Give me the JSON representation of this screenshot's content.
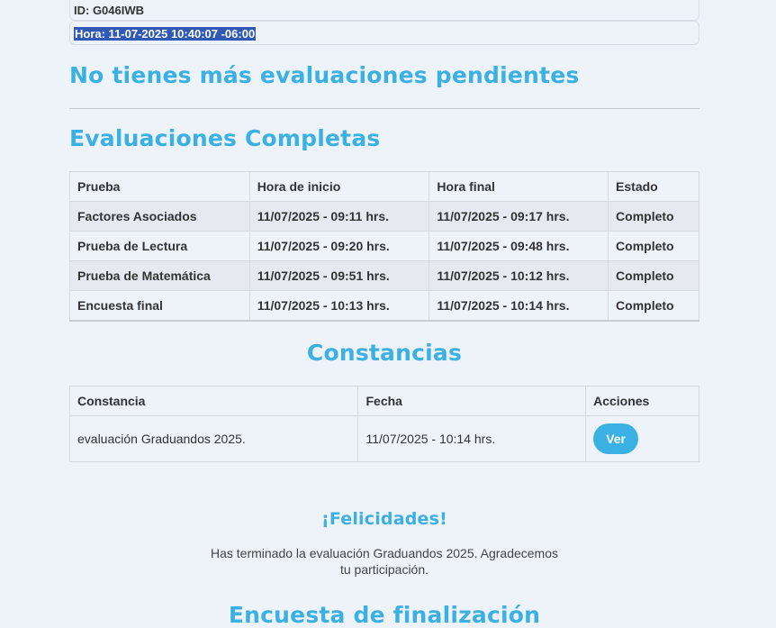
{
  "info": {
    "id_text": "ID: G046IWB",
    "hora_text": "Hora: 11-07-2025 10:40:07 -06:00"
  },
  "pending_title": "No tienes más evaluaciones pendientes",
  "completed": {
    "title": "Evaluaciones Completas",
    "headers": [
      "Prueba",
      "Hora de inicio",
      "Hora final",
      "Estado"
    ],
    "rows": [
      [
        "Factores Asociados",
        "11/07/2025 - 09:11 hrs.",
        "11/07/2025 - 09:17 hrs.",
        "Completo"
      ],
      [
        "Prueba de Lectura",
        "11/07/2025 - 09:20 hrs.",
        "11/07/2025 - 09:48 hrs.",
        "Completo"
      ],
      [
        "Prueba de Matemática",
        "11/07/2025 - 09:51 hrs.",
        "11/07/2025 - 10:12 hrs.",
        "Completo"
      ],
      [
        "Encuesta final",
        "11/07/2025 - 10:13 hrs.",
        "11/07/2025 - 10:14 hrs.",
        "Completo"
      ]
    ]
  },
  "constancias": {
    "title": "Constancias",
    "headers": [
      "Constancia",
      "Fecha",
      "Acciones"
    ],
    "rows": [
      [
        "evaluación Graduandos 2025.",
        "11/07/2025 - 10:14 hrs.",
        "Ver"
      ]
    ]
  },
  "felicidades": {
    "title": "¡Felicidades!",
    "message": "Has terminado la evaluación Graduandos 2025. Agradecemos tu participación."
  },
  "partial_title": "Encuesta de finalización"
}
